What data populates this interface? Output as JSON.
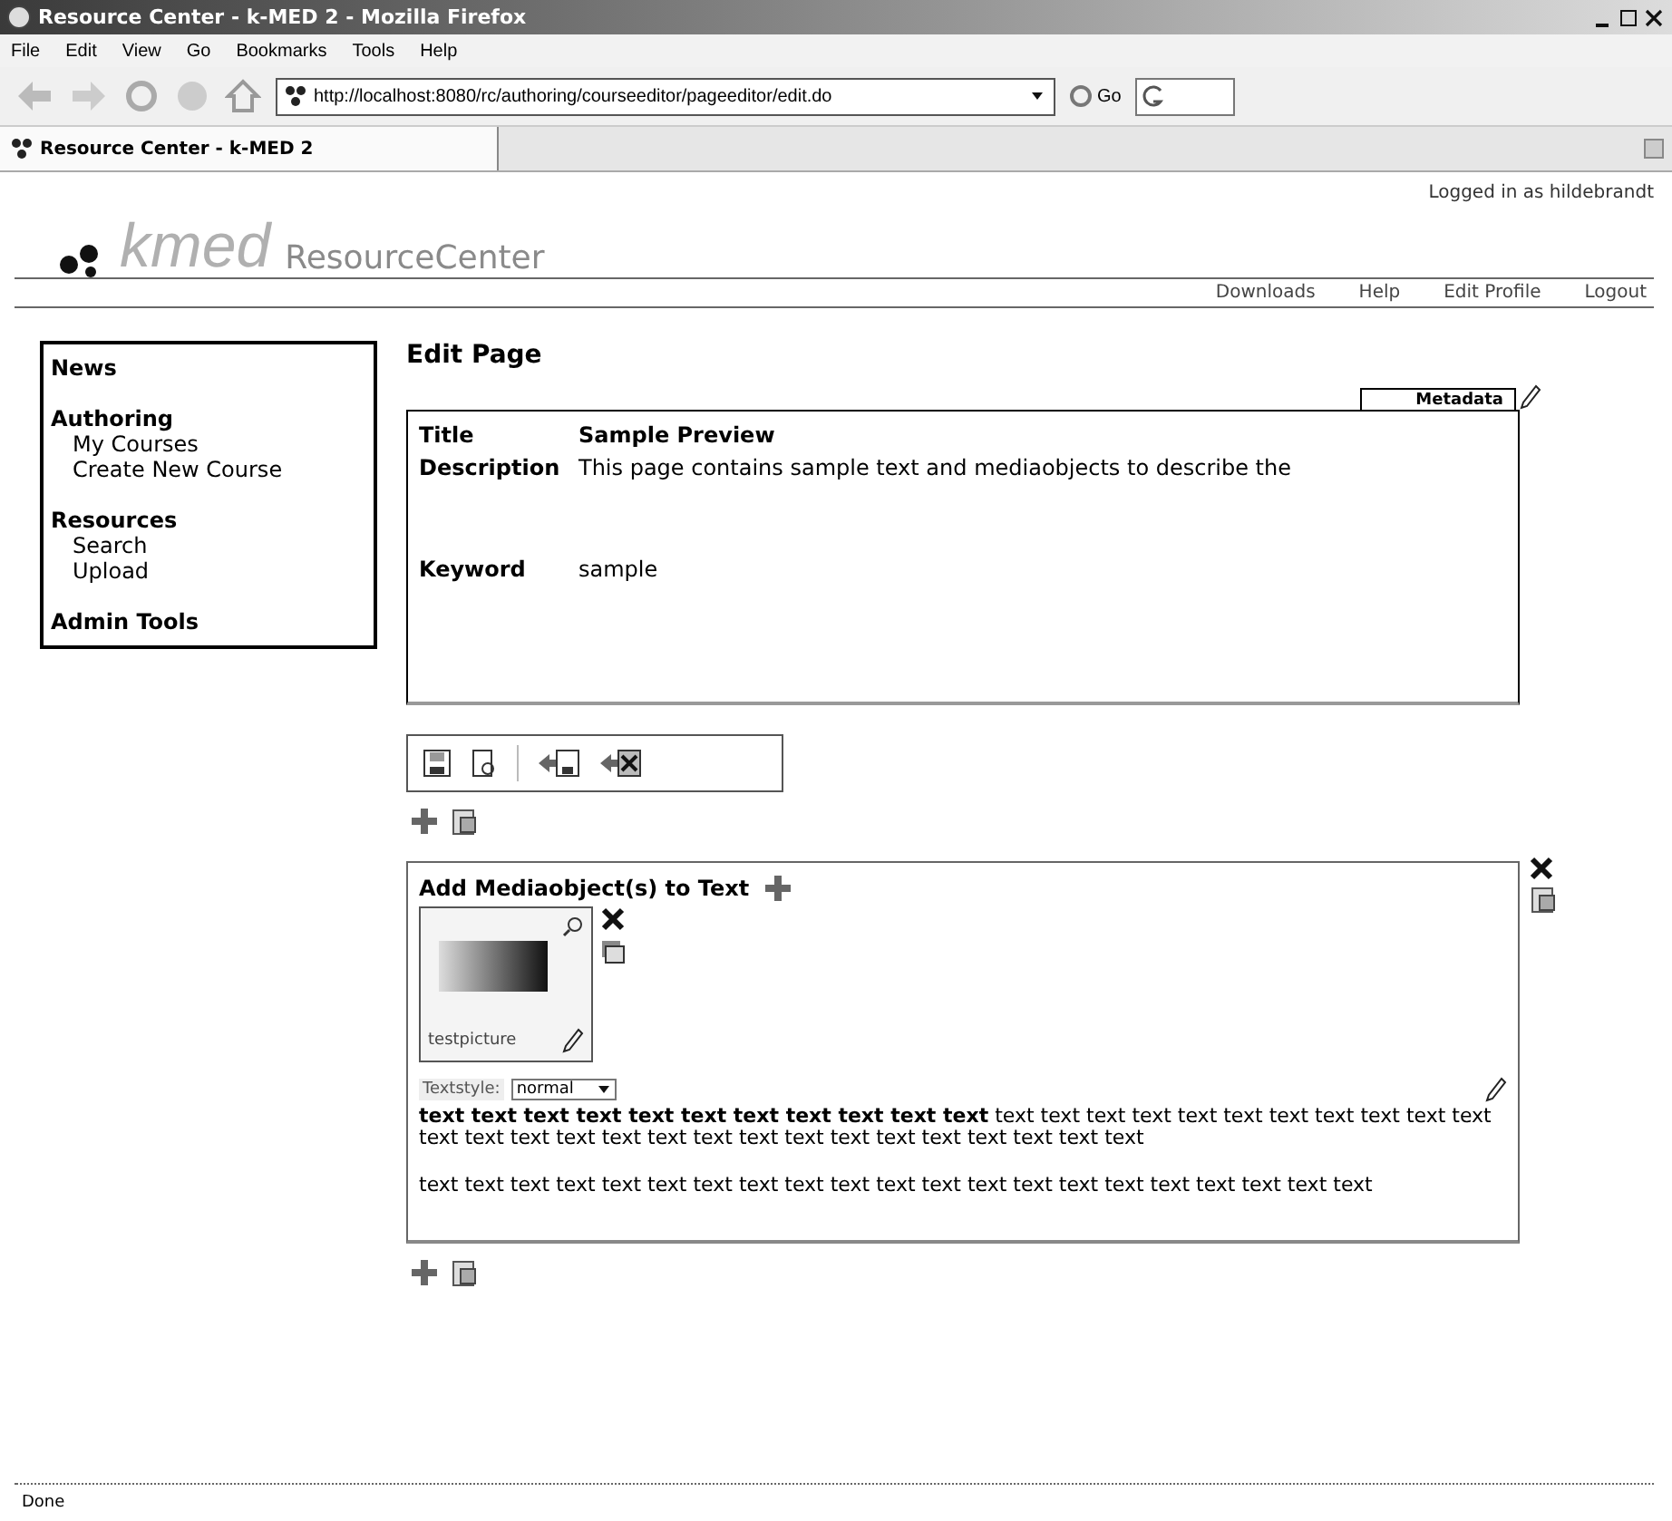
{
  "window": {
    "title": "Resource Center - k-MED 2 - Mozilla Firefox"
  },
  "menu": [
    "File",
    "Edit",
    "View",
    "Go",
    "Bookmarks",
    "Tools",
    "Help"
  ],
  "address_bar": {
    "url": "http://localhost:8080/rc/authoring/courseeditor/pageeditor/edit.do",
    "go": "Go"
  },
  "tabs": [
    {
      "label": "Resource Center - k-MED 2",
      "selected": true
    }
  ],
  "site": {
    "logo": "kmed",
    "subtitle": "ResourceCenter",
    "logged_in": "Logged in as hildebrandt",
    "links": [
      "Downloads",
      "Help",
      "Edit Profile",
      "Logout"
    ]
  },
  "sidebar": [
    {
      "label": "News"
    },
    {
      "label": "Authoring",
      "children": [
        {
          "label": "My Courses"
        },
        {
          "label": "Create New Course"
        }
      ]
    },
    {
      "label": "Resources",
      "children": [
        {
          "label": "Search"
        },
        {
          "label": "Upload"
        }
      ]
    },
    {
      "label": "Admin Tools"
    }
  ],
  "page": {
    "heading": "Edit Page",
    "metadata_tab": "Metadata",
    "fields": [
      {
        "label": "Title",
        "value": "Sample Preview",
        "kind": "title"
      },
      {
        "label": "Description",
        "value": "This page contains sample text and mediaobjects to describe the",
        "kind": "text"
      },
      {
        "label": "Keyword",
        "value": "sample",
        "kind": "text"
      }
    ]
  },
  "block": {
    "heading": "Add Mediaobject(s) to Text",
    "media": {
      "caption": "testpicture"
    },
    "textstyle": {
      "label": "Textstyle:",
      "value": "normal"
    },
    "paragraphs": [
      "**text text text text text text text text text text text** text text text text text text text text text text text text text text text text text text text text text text text text text text text",
      "text text text text text text text text text text text text text text text text text text text text text"
    ]
  },
  "status_bar": "Done"
}
